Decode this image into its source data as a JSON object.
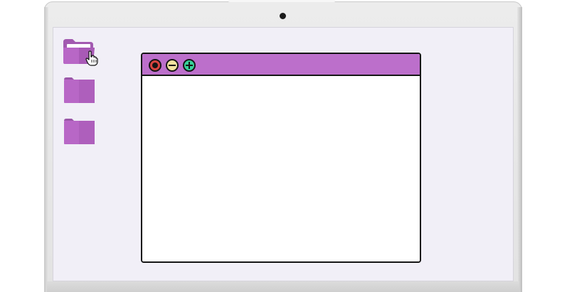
{
  "device": {
    "camera_icon": "webcam-dot"
  },
  "desktop": {
    "background_color": "#f1eff7",
    "folders": [
      {
        "icon": "folder-open-icon",
        "state": "hovered"
      },
      {
        "icon": "folder-icon",
        "state": "default"
      },
      {
        "icon": "folder-icon",
        "state": "default"
      }
    ],
    "cursor_icon": "hand-pointer-icon",
    "folder_color": "#b867c6"
  },
  "window": {
    "titlebar_color": "#bc6fcb",
    "controls": [
      {
        "name": "close",
        "icon": "close-circle-icon",
        "color": "#d8433e"
      },
      {
        "name": "minimize",
        "icon": "minus-circle-icon",
        "color": "#f3e3a0"
      },
      {
        "name": "maximize",
        "icon": "plus-circle-icon",
        "color": "#37d199"
      }
    ]
  }
}
